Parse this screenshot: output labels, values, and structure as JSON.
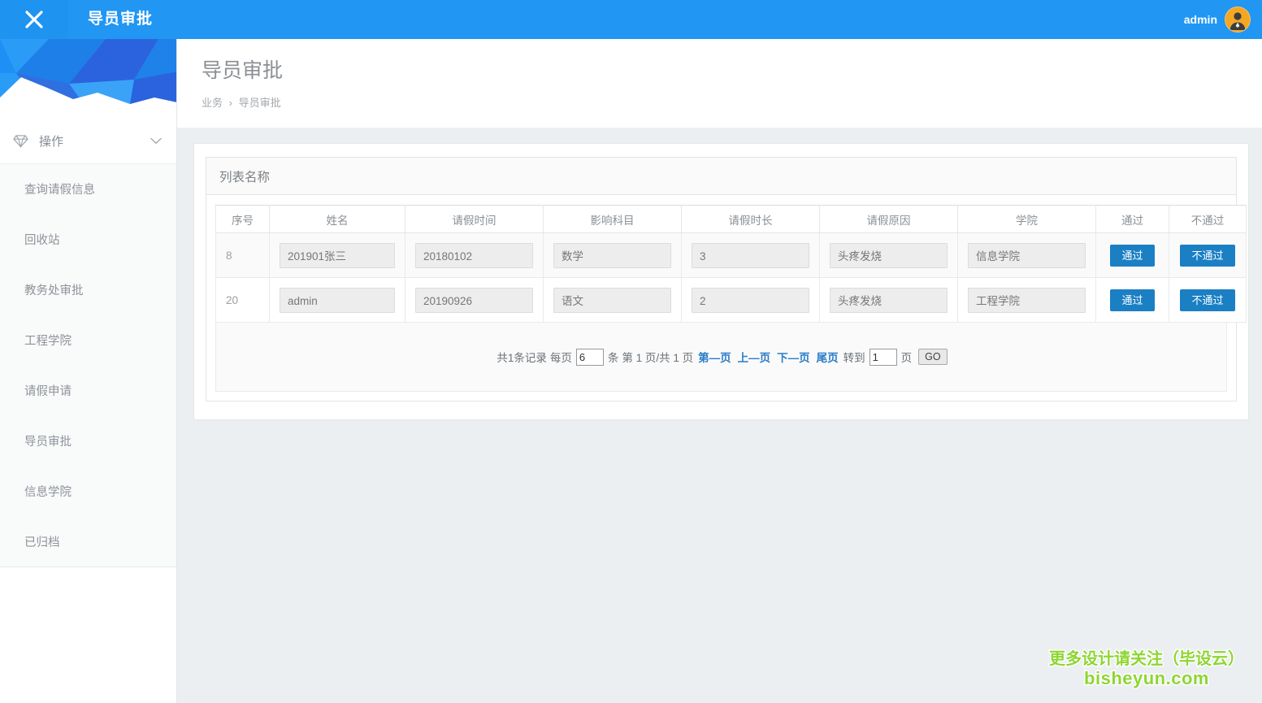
{
  "topbar": {
    "close_icon": "close-x-icon",
    "title": "导员审批",
    "username": "admin",
    "avatar_icon": "user-avatar-icon",
    "bg_color": "#2196f3"
  },
  "sidebar": {
    "banner_icon": "polygon-banner-graphic",
    "group": {
      "icon": "diamond-icon",
      "label": "操作",
      "chevron_icon": "chevron-down-icon"
    },
    "items": [
      {
        "label": "查询请假信息"
      },
      {
        "label": "回收站"
      },
      {
        "label": "教务处审批"
      },
      {
        "label": "工程学院"
      },
      {
        "label": "请假申请"
      },
      {
        "label": "导员审批"
      },
      {
        "label": "信息学院"
      },
      {
        "label": "已归档"
      }
    ]
  },
  "page": {
    "title": "导员审批",
    "breadcrumb": {
      "root": "业务",
      "separator": "›",
      "current": "导员审批"
    }
  },
  "panel": {
    "title": "列表名称"
  },
  "table": {
    "columns": [
      "序号",
      "姓名",
      "请假时间",
      "影响科目",
      "请假时长",
      "请假原因",
      "学院",
      "通过",
      "不通过"
    ],
    "rows": [
      {
        "seq": "8",
        "name": "201901张三",
        "leave_date": "20180102",
        "subject": "数学",
        "duration": "3",
        "reason": "头疼发烧",
        "college": "信息学院",
        "approve_label": "通过",
        "reject_label": "不通过"
      },
      {
        "seq": "20",
        "name": "admin",
        "leave_date": "20190926",
        "subject": "语文",
        "duration": "2",
        "reason": "头疼发烧",
        "college": "工程学院",
        "approve_label": "通过",
        "reject_label": "不通过"
      }
    ]
  },
  "pager": {
    "total_text": "共1条记录",
    "per_page_label": "每页",
    "per_page_value": "6",
    "per_page_unit": "条",
    "page_prefix": "第 1 页/共 1 页",
    "first": "第—页",
    "prev": "上—页",
    "next": "下—页",
    "last": "尾页",
    "goto_label": "转到",
    "goto_value": "1",
    "goto_unit": "页",
    "go_button": "GO"
  },
  "watermark": {
    "line1": "更多设计请关注（毕设云）",
    "line2": "bisheyun.com",
    "color": "#8ed632"
  }
}
